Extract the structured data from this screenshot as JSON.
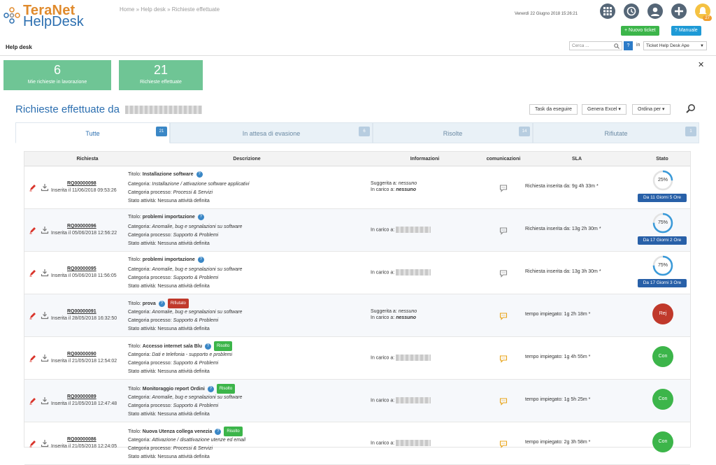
{
  "app": {
    "logo_line1": "TeraNet",
    "logo_line2": "HelpDesk"
  },
  "breadcrumb": {
    "home": "Home",
    "sep": "»",
    "helpdesk": "Help desk",
    "current": "Richieste effettuate"
  },
  "header": {
    "datetime": "Venerdì 22 Giugno 2018 15:26:21",
    "notifications_count": "27",
    "new_ticket_label": "+ Nuovo ticket",
    "manual_label": "? Manuale"
  },
  "subbar": {
    "title": "Help desk",
    "search_placeholder": "Cerca ...",
    "help_label": "?",
    "in_label": "in",
    "search_scope": "Ticket Help Desk Ape"
  },
  "cards": [
    {
      "value": "6",
      "label": "Mie richieste in lavorazione"
    },
    {
      "value": "21",
      "label": "Richieste effettuate"
    }
  ],
  "page_title": "Richieste effettuate da",
  "toolbar": {
    "task": "Task da eseguire",
    "excel": "Genera Excel",
    "order": "Ordina per"
  },
  "tabs": [
    {
      "label": "Tutte",
      "count": "21"
    },
    {
      "label": "In attesa di evasione",
      "count": "6"
    },
    {
      "label": "Risolte",
      "count": "14"
    },
    {
      "label": "Rifiutate",
      "count": "1"
    }
  ],
  "columns": [
    "Richiesta",
    "Descrizione",
    "Informazioni",
    "comunicazioni",
    "SLA",
    "Stato"
  ],
  "labels": {
    "titolo": "Titolo:",
    "categoria": "Categoria:",
    "categoria_processo": "Categoria processo:",
    "stato_attivita": "Stato attività:",
    "suggerita": "Suggerita a:",
    "in_carico": "In carico a:"
  },
  "rows": [
    {
      "code": "RQ00000098",
      "inserted": "Inserita il 11/06/2018 09:53:26",
      "title": "Installazione software",
      "tag": "",
      "categoria": "Installazione / attivazione software applicativi",
      "processo": "Processi & Servizi",
      "stato": "Nessuna attività definita",
      "suggerita": "nessuno",
      "in_carico": "nessuno",
      "sla": "Richiesta inserita da: 9g 4h 33m *",
      "stato_type": "ring",
      "progress": "25%",
      "duration": "Da 11 Giorni 5 Ore",
      "comm_color": "#888"
    },
    {
      "code": "RQ00000096",
      "inserted": "Inserita il 05/06/2018 12:56:22",
      "title": "problemi importazione",
      "tag": "",
      "categoria": "Anomalie, bug e segnalazioni su software",
      "processo": "Supporto & Problemi",
      "stato": "Nessuna attività definita",
      "suggerita": "",
      "in_carico": "",
      "sla": "Richiesta inserita da: 13g 2h 30m *",
      "stato_type": "ring",
      "progress": "75%",
      "duration": "Da 17 Giorni 2 Ore",
      "comm_color": "#888"
    },
    {
      "code": "RQ00000095",
      "inserted": "Inserita il 05/06/2018 11:56:05",
      "title": "problemi importazione",
      "tag": "",
      "categoria": "Anomalie, bug e segnalazioni su software",
      "processo": "Supporto & Problemi",
      "stato": "Nessuna attività definita",
      "suggerita": "",
      "in_carico": "",
      "sla": "Richiesta inserita da: 13g 3h 30m *",
      "stato_type": "ring",
      "progress": "75%",
      "duration": "Da 17 Giorni 3 Ore",
      "comm_color": "#888"
    },
    {
      "code": "RQ00000091",
      "inserted": "Inserita il 28/05/2018 16:32:50",
      "title": "prova",
      "tag": "Rifiutato",
      "categoria": "Anomalie, bug e segnalazioni su software",
      "processo": "Supporto & Problemi",
      "stato": "Nessuna attività definita",
      "suggerita": "nessuno",
      "in_carico": "nessuno",
      "sla": "tempo impiegato: 1g 2h 18m *",
      "stato_type": "rej",
      "status_text": "Rej",
      "comm_color": "#e8a317"
    },
    {
      "code": "RQ00000090",
      "inserted": "Inserita il 21/05/2018 12:54:02",
      "title": "Accesso internet sala Blu",
      "tag": "Risolto",
      "categoria": "Dati e telefonia - supporto e problemi",
      "processo": "Supporto & Problemi",
      "stato": "Nessuna attività definita",
      "suggerita": "",
      "in_carico": "",
      "sla": "tempo impiegato: 1g 4h 55m *",
      "stato_type": "con",
      "status_text": "Con",
      "comm_color": "#e8a317"
    },
    {
      "code": "RQ00000089",
      "inserted": "Inserita il 21/05/2018 12:47:48",
      "title": "Monitoraggio report Ordini",
      "tag": "Risolto",
      "categoria": "Anomalie, bug e segnalazioni su software",
      "processo": "Supporto & Problemi",
      "stato": "Nessuna attività definita",
      "suggerita": "",
      "in_carico": "",
      "sla": "tempo impiegato: 1g 5h 25m *",
      "stato_type": "con",
      "status_text": "Con",
      "comm_color": "#e8a317"
    },
    {
      "code": "RQ00000086",
      "inserted": "Inserita il 21/05/2018 12:24:05",
      "title": "Nuova Utenza collega venezia",
      "tag": "Risolto",
      "categoria": "Attivazione / disattivazione utenze ed email",
      "processo": "Processi & Servizi",
      "stato": "Nessuna attività definita",
      "suggerita": "",
      "in_carico": "",
      "sla": "tempo impiegato: 2g 3h 58m *",
      "stato_type": "con",
      "status_text": "Con",
      "comm_color": "#e8a317"
    }
  ],
  "colors": {
    "accent": "#2c6fb0",
    "card": "#6fc595",
    "reject": "#c0392b",
    "success": "#3cb54a",
    "duration": "#2860a8"
  }
}
